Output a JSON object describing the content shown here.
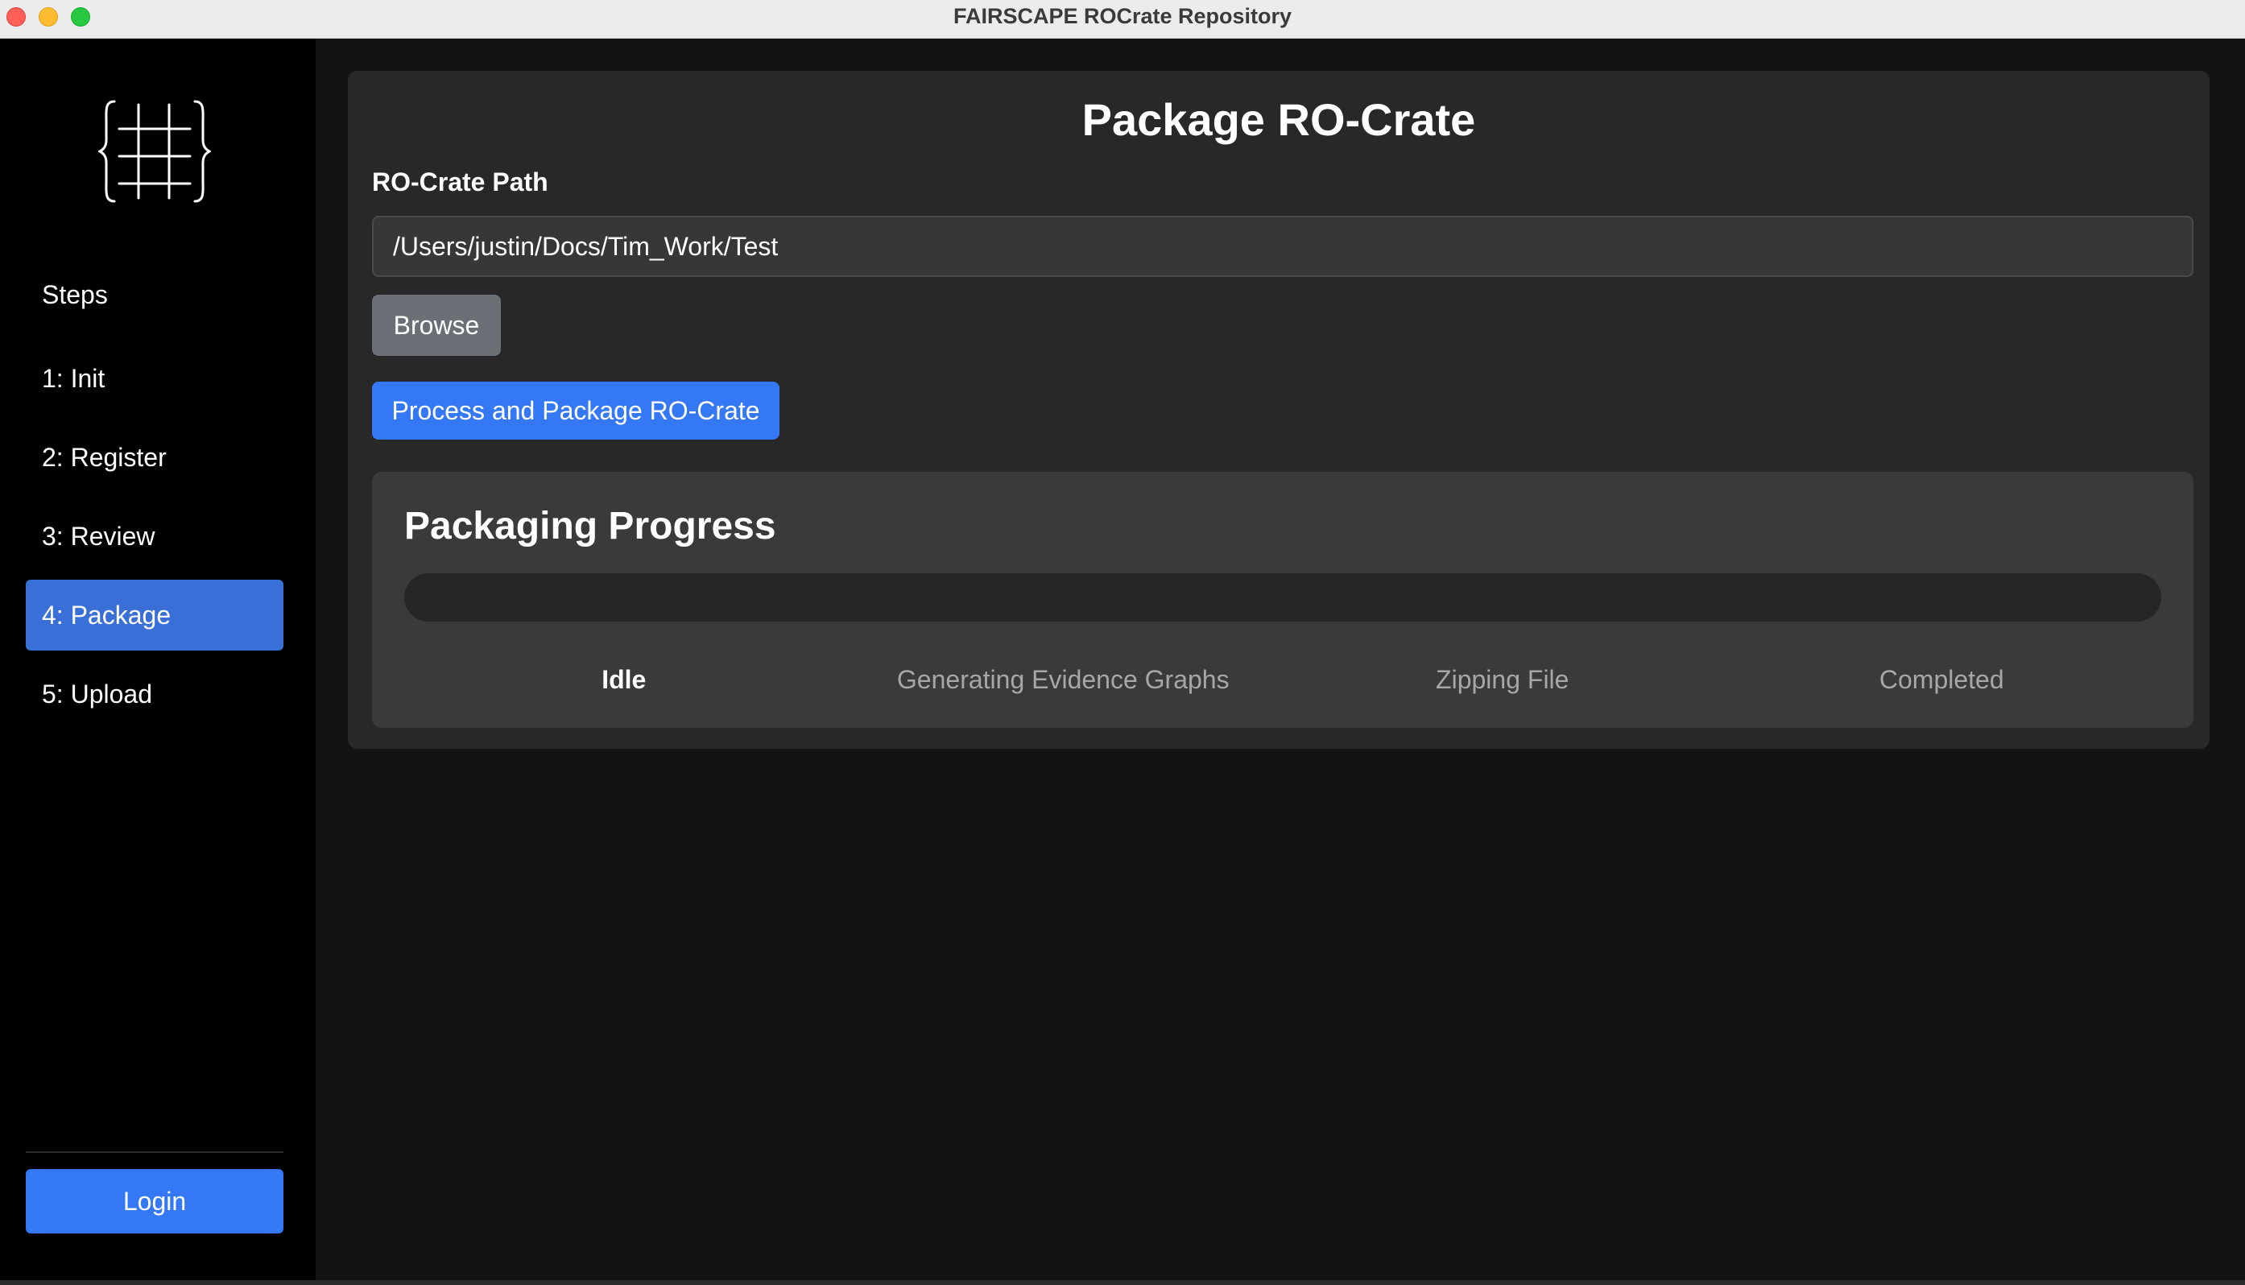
{
  "window": {
    "title": "FAIRSCAPE ROCrate Repository"
  },
  "sidebar": {
    "logo_icon": "braces-grid-logo-icon",
    "heading": "Steps",
    "items": [
      {
        "label": "1: Init",
        "active": false
      },
      {
        "label": "2: Register",
        "active": false
      },
      {
        "label": "3: Review",
        "active": false
      },
      {
        "label": "4: Package",
        "active": true
      },
      {
        "label": "5: Upload",
        "active": false
      }
    ],
    "login_label": "Login"
  },
  "main": {
    "title": "Package RO-Crate",
    "path_label": "RO-Crate Path",
    "path_value": "/Users/justin/Docs/Tim_Work/Test",
    "browse_label": "Browse",
    "process_label": "Process and Package RO-Crate",
    "progress": {
      "title": "Packaging Progress",
      "fraction": 0,
      "stages": [
        "Idle",
        "Generating Evidence Graphs",
        "Zipping File",
        "Completed"
      ],
      "current_stage": 0
    }
  },
  "colors": {
    "accent": "#3478f6",
    "active_nav": "#3a6fd8",
    "secondary_button": "#6b7076",
    "card": "#282828",
    "panel": "#3a3a3a"
  }
}
